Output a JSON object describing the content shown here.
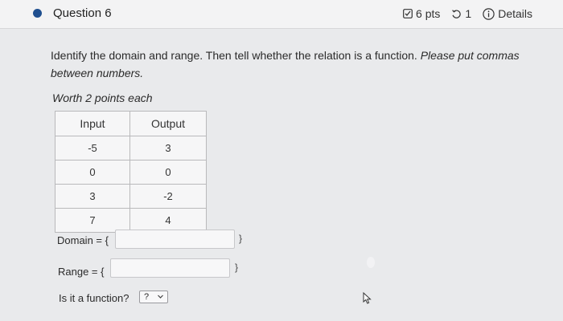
{
  "header": {
    "question_title": "Question 6",
    "points": "6 pts",
    "attempts": "1",
    "details_label": "Details"
  },
  "prompt": {
    "text": "Identify the domain and range. Then tell whether the relation is a function.",
    "instruction": "Please put commas between numbers.",
    "worth": "Worth 2 points each"
  },
  "table": {
    "headers": [
      "Input",
      "Output"
    ],
    "rows": [
      [
        "-5",
        "3"
      ],
      [
        "0",
        "0"
      ],
      [
        "3",
        "-2"
      ],
      [
        "7",
        "4"
      ]
    ]
  },
  "answers": {
    "domain_label": "Domain = {",
    "range_label": "Range = {",
    "close_brace": "}",
    "function_question": "Is it a function?",
    "function_select_value": "?"
  },
  "icons": {
    "points_icon": "checkbox-edit-icon",
    "retry_icon": "retry-icon",
    "info_icon": "info-icon",
    "bullet": "question-dot-icon",
    "cursor": "mouse-pointer-icon"
  },
  "colors": {
    "accent": "#1f4f8f",
    "background": "#e9eaec"
  }
}
